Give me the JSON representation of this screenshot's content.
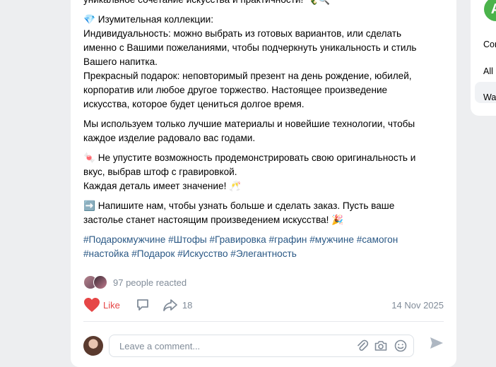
{
  "post": {
    "paragraphs": [
      {
        "emoji": "",
        "lines": [
          "уникальное сочетание искусства и практичности! 🍾🔍"
        ]
      },
      {
        "emoji": "💎",
        "lines": [
          "Изумительная коллекции:",
          "Индивидуальность: можно выбрать из готовых вариантов, или сделать",
          "именно с Вашими пожеланиями, чтобы подчеркнуть уникальность и стиль",
          "Вашего напитка.",
          "Прекрасный подарок: неповторимый презент на день рождение, юбилей,",
          "корпоратив или любое другое торжество. Настоящее произведение",
          "искусства, которое будет цениться долгое время."
        ]
      },
      {
        "emoji": "",
        "lines": [
          "Мы используем только лучшие материалы и новейшие технологии, чтобы",
          "каждое изделие радовало вас годами."
        ]
      },
      {
        "emoji": "🍬",
        "lines": [
          "Не упустите возможность продемонстрировать свою оригинальность и",
          "вкус, выбрав штоф с гравировкой.",
          "Каждая деталь имеет значение! 🥂"
        ]
      },
      {
        "emoji": "➡️",
        "lines": [
          "Напишите нам, чтобы узнать больше и сделать заказ. Пусть ваше",
          "застолье станет настоящим произведением искусства! 🎉"
        ]
      }
    ],
    "hashtags": [
      "#Подарокмужчине",
      "#Штофы",
      "#Гравировка",
      "#графин",
      "#мужчине",
      "#самогон",
      "#настойка",
      "#Подарок",
      "#Искусство",
      "#Элегантность"
    ],
    "reactions_text": "97 people reacted",
    "like_label": "Like",
    "share_count": "18",
    "date": "14 Nov 2025"
  },
  "comment": {
    "placeholder": "Leave a comment..."
  },
  "sidebar": {
    "logo_letter": "A",
    "items": [
      "Cor",
      "All",
      "Wa"
    ]
  },
  "colors": {
    "accent": "#2a5885",
    "like": "#e64646",
    "muted": "#818c99",
    "background": "#edeef0"
  }
}
